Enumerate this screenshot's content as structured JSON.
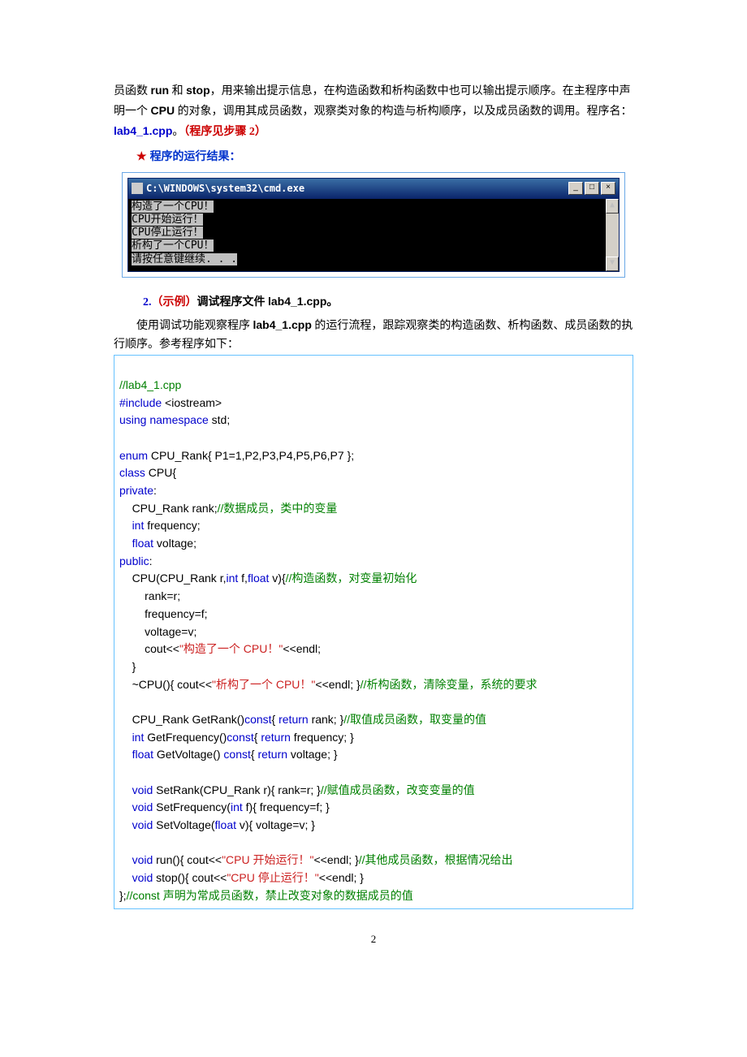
{
  "intro": {
    "line1_a": "员函数 ",
    "run": "run",
    "line1_b": " 和 ",
    "stop": "stop",
    "line1_c": "，用来输出提示信息，在构造函数和析构函数中也可以输出提示顺序。在主程序中声明一个 ",
    "cpu": "CPU",
    "line1_d": " 的对象，调用其成员函数，观察类对象的构造与析构顺序，以及成员函数的调用。程序名：",
    "file": "lab4_1.cpp",
    "line1_e": "。",
    "step": "（程序见步骤 2）"
  },
  "result_title": "程序的运行结果：",
  "console": {
    "title": "C:\\WINDOWS\\system32\\cmd.exe",
    "lines": [
      "构造了一个CPU！",
      "CPU开始运行！",
      "CPU停止运行！",
      "析构了一个CPU！",
      "请按任意键继续. . ."
    ],
    "min_icon": "_",
    "max_icon": "□",
    "close_icon": "×",
    "up_icon": "▲",
    "down_icon": "▼"
  },
  "section2": {
    "num": "2.",
    "red": "（示例）",
    "rest": "调试程序文件 ",
    "file": "lab4_1.cpp",
    "end": "。",
    "desc_a": "使用调试功能观察程序 ",
    "desc_file": "lab4_1.cpp",
    "desc_b": " 的运行流程，跟踪观察类的构造函数、析构函数、成员函数的执行顺序。参考程序如下："
  },
  "code": {
    "l01": "//lab4_1.cpp",
    "l02a": "#include",
    "l02b": " <iostream>",
    "l03a": "using namespace",
    "l03b": " std;",
    "l04": "",
    "l05a": "enum",
    "l05b": " CPU_Rank{ P1=1,P2,P3,P4,P5,P6,P7 };",
    "l06a": "class",
    "l06b": " CPU{",
    "l07a": "private",
    "l07b": ":",
    "l08a": "    CPU_Rank rank;",
    "l08c": "//数据成员，类中的变量",
    "l09a": "    ",
    "l09k": "int",
    "l09b": " frequency;",
    "l10a": "    ",
    "l10k": "float",
    "l10b": " voltage;",
    "l11a": "public",
    "l11b": ":",
    "l12a": "    CPU(CPU_Rank r,",
    "l12k1": "int",
    "l12b": " f,",
    "l12k2": "float",
    "l12c": " v){",
    "l12cm": "//构造函数，对变量初始化",
    "l13": "        rank=r;",
    "l14": "        frequency=f;",
    "l15": "        voltage=v;",
    "l16a": "        cout<<",
    "l16s": "\"构造了一个 CPU！\"",
    "l16b": "<<endl;",
    "l17": "    }",
    "l18a": "    ~CPU(){ cout<<",
    "l18s": "\"析构了一个 CPU！\"",
    "l18b": "<<endl; }",
    "l18cm": "//析构函数，清除变量，系统的要求",
    "l19": "",
    "l20a": "    CPU_Rank GetRank()",
    "l20k": "const",
    "l20b": "{ ",
    "l20r": "return",
    "l20c": " rank; }",
    "l20cm": "//取值成员函数，取变量的值",
    "l21a": "    ",
    "l21k1": "int",
    "l21b": " GetFrequency()",
    "l21k2": "const",
    "l21c": "{ ",
    "l21r": "return",
    "l21d": " frequency; }",
    "l22a": "    ",
    "l22k1": "float",
    "l22b": " GetVoltage() ",
    "l22k2": "const",
    "l22c": "{ ",
    "l22r": "return",
    "l22d": " voltage; }",
    "l23": "",
    "l24a": "    ",
    "l24k": "void",
    "l24b": " SetRank(CPU_Rank r){ rank=r; }",
    "l24cm": "//赋值成员函数，改变变量的值",
    "l25a": "    ",
    "l25k": "void",
    "l25b": " SetFrequency(",
    "l25k2": "int",
    "l25c": " f){ frequency=f; }",
    "l26a": "    ",
    "l26k": "void",
    "l26b": " SetVoltage(",
    "l26k2": "float",
    "l26c": " v){ voltage=v; }",
    "l27": "",
    "l28a": "    ",
    "l28k": "void",
    "l28b": " run(){ cout<<",
    "l28s": "\"CPU 开始运行！\"",
    "l28c": "<<endl; }",
    "l28cm": "//其他成员函数，根据情况给出",
    "l29a": "    ",
    "l29k": "void",
    "l29b": " stop(){ cout<<",
    "l29s": "\"CPU 停止运行！\"",
    "l29c": "<<endl; }",
    "l30a": "};",
    "l30cm": "//const 声明为常成员函数，禁止改变对象的数据成员的值"
  },
  "page_number": "2"
}
